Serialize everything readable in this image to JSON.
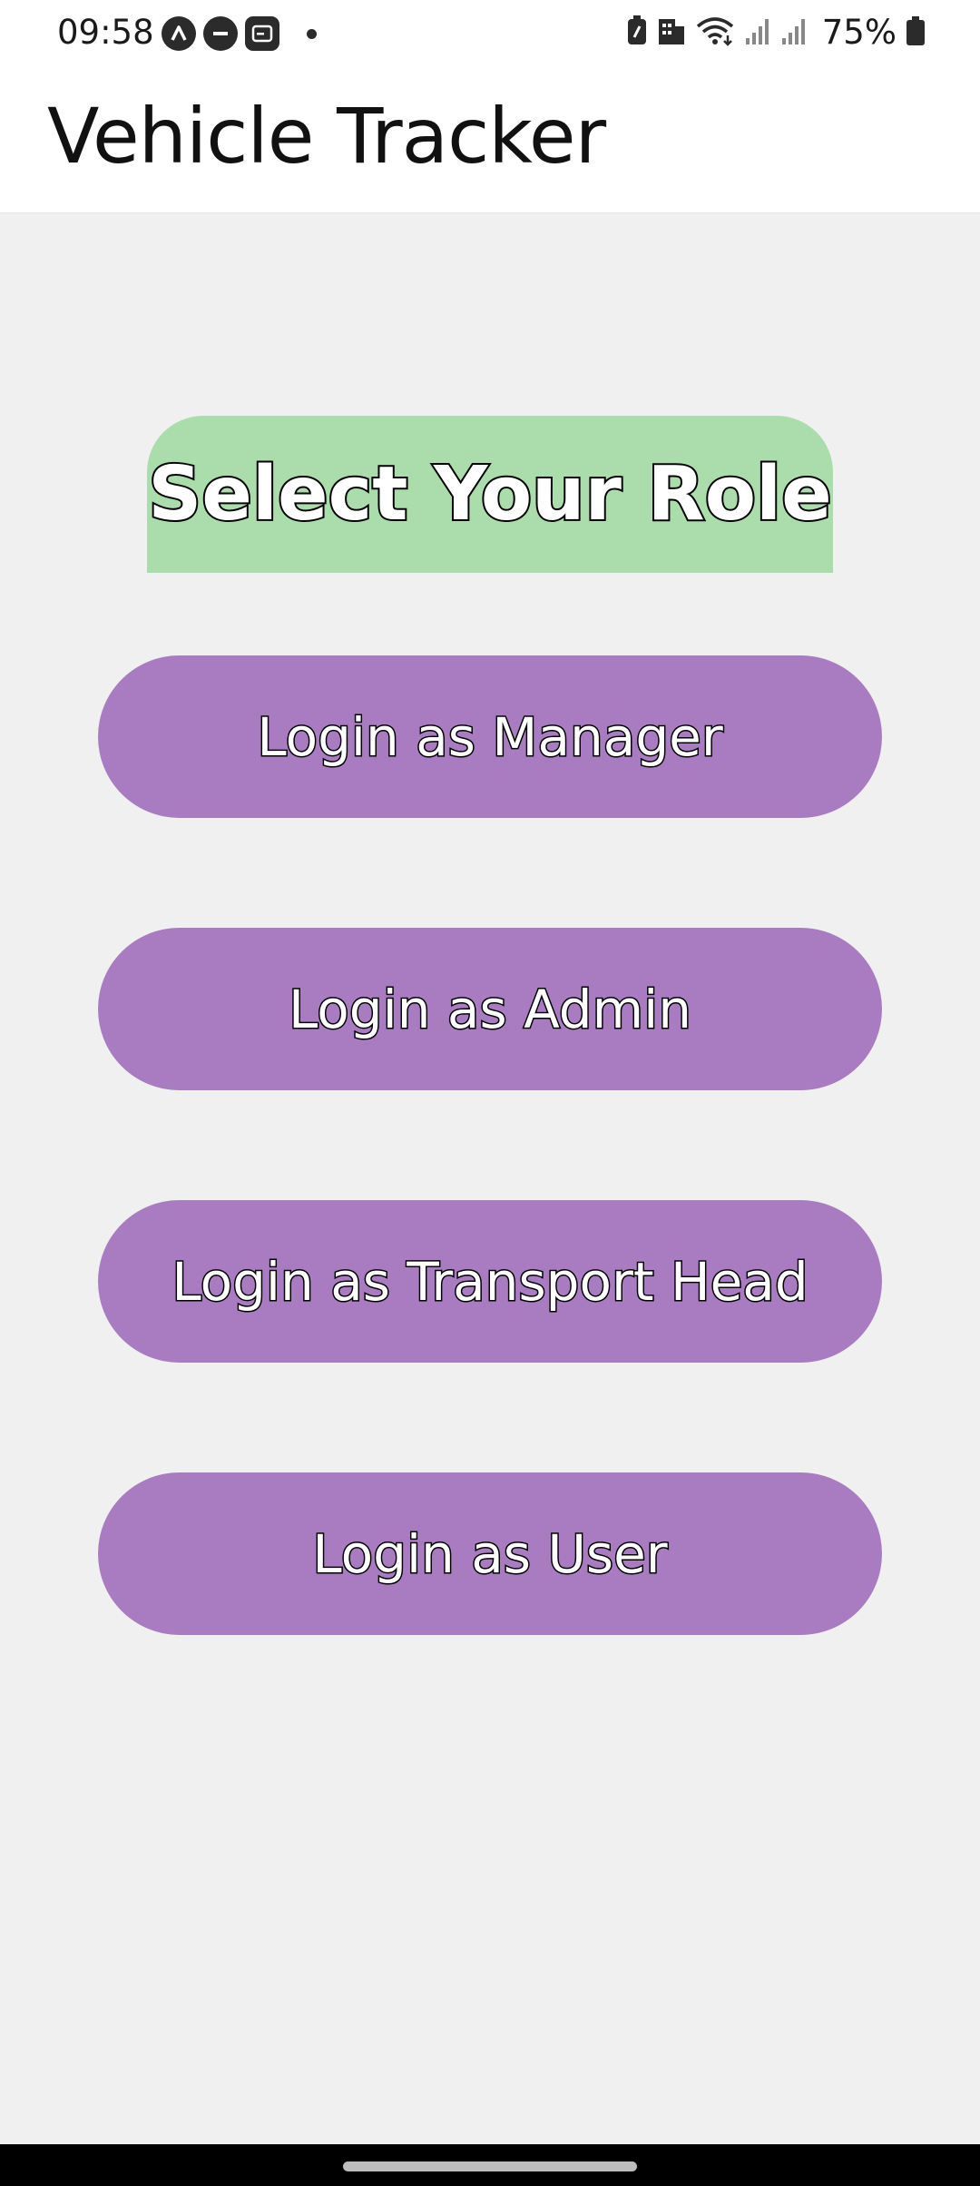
{
  "status_bar": {
    "time": "09:58",
    "left_icons": [
      "autostart-icon",
      "do-not-disturb-icon",
      "screen-icon",
      "notification-dot-icon"
    ],
    "right_icons": [
      "battery-saver-icon",
      "building-icon",
      "wifi-icon",
      "signal-icon",
      "signal-icon-2"
    ],
    "battery_percent": "75%"
  },
  "app_bar": {
    "title": "Vehicle Tracker"
  },
  "main": {
    "heading": "Select Your Role",
    "buttons": [
      {
        "label": "Login as Manager"
      },
      {
        "label": "Login as Admin"
      },
      {
        "label": "Login as Transport Head"
      },
      {
        "label": "Login as User"
      }
    ]
  },
  "colors": {
    "heading_bg": "#abdcab",
    "button_bg": "#a97cc2",
    "page_bg": "#f0f0f0"
  }
}
